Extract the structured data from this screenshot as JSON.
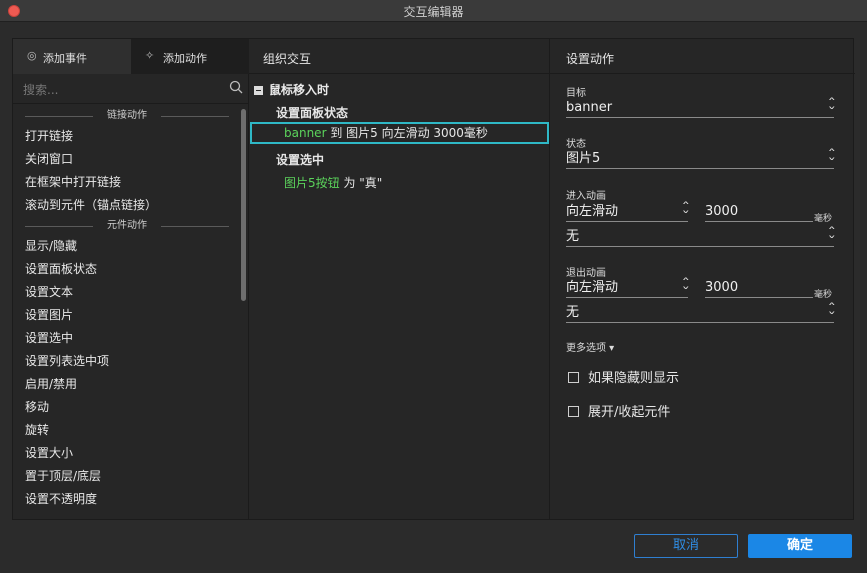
{
  "window": {
    "title": "交互编辑器"
  },
  "left_panel": {
    "tabs": [
      {
        "label": "添加事件",
        "icon": "event-icon",
        "active": true
      },
      {
        "label": "添加动作",
        "icon": "sparkle-icon",
        "active": false
      }
    ],
    "search": {
      "placeholder": "搜索..."
    },
    "sections": [
      {
        "title": "链接动作",
        "items": [
          "打开链接",
          "关闭窗口",
          "在框架中打开链接",
          "滚动到元件（锚点链接）"
        ]
      },
      {
        "title": "元件动作",
        "items": [
          "显示/隐藏",
          "设置面板状态",
          "设置文本",
          "设置图片",
          "设置选中",
          "设置列表选中项",
          "启用/禁用",
          "移动",
          "旋转",
          "设置大小",
          "置于顶层/底层",
          "设置不透明度"
        ]
      }
    ]
  },
  "middle_panel": {
    "title": "组织交互",
    "event": "鼠标移入时",
    "cases": [
      {
        "label": "设置面板状态",
        "action": {
          "target": "banner",
          "text": " 到 图片5 向左滑动 3000毫秒"
        }
      },
      {
        "label": "设置选中",
        "action": {
          "target": "图片5按钮",
          "text": " 为 \"真\""
        }
      }
    ]
  },
  "right_panel": {
    "title": "设置动作",
    "target_label": "目标",
    "target_value": "banner",
    "state_label": "状态",
    "state_value": "图片5",
    "enter_label": "进入动画",
    "enter_anim": "向左滑动",
    "enter_duration": "3000",
    "enter_unit": "毫秒",
    "enter_easing": "无",
    "exit_label": "退出动画",
    "exit_anim": "向左滑动",
    "exit_duration": "3000",
    "exit_unit": "毫秒",
    "exit_easing": "无",
    "more_label": "更多选项 ▾",
    "checkboxes": [
      "如果隐藏则显示",
      "展开/收起元件"
    ]
  },
  "footer": {
    "cancel": "取消",
    "ok": "确定"
  },
  "colors": {
    "accent": "#1b87e6",
    "highlight": "#2fb8c6",
    "green": "#5bd35b"
  }
}
